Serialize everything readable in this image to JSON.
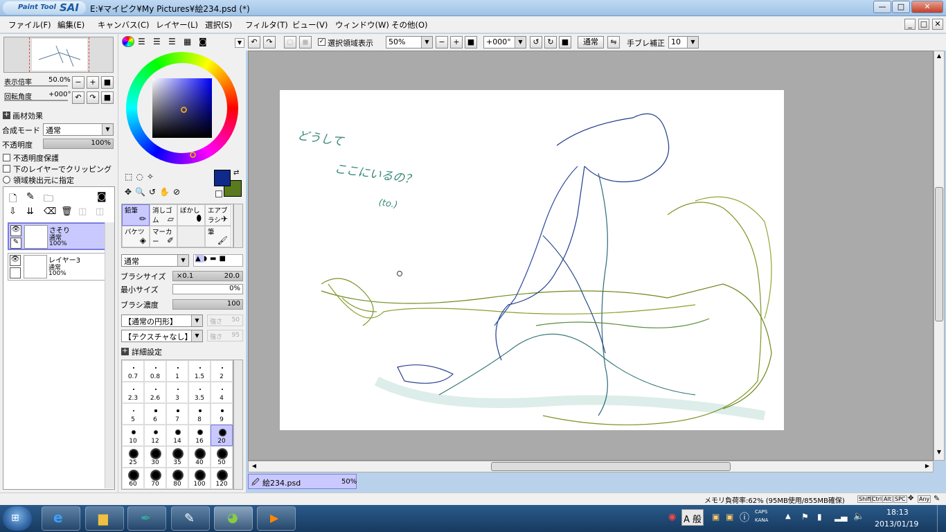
{
  "window": {
    "app_logo_text": "Paint Tool",
    "app_logo_brand": "SAI",
    "title": "E:¥マイピク¥My Pictures¥絵234.psd (*)",
    "minimize": "—",
    "maximize": "□",
    "close": "✕"
  },
  "menu": [
    "ファイル(F)",
    "編集(E)",
    "キャンバス(C)",
    "レイヤー(L)",
    "選択(S)",
    "フィルタ(T)",
    "ビュー(V)",
    "ウィンドウ(W)",
    "その他(O)"
  ],
  "navigator": {
    "zoom_label": "表示倍率",
    "zoom_value": "50.0%",
    "rotation_label": "回転角度",
    "rotation_value": "+000°"
  },
  "layer_effects": {
    "header": "画材効果",
    "blend_mode_label": "合成モード",
    "blend_mode_value": "通常",
    "opacity_label": "不透明度",
    "opacity_value": "100%",
    "opacity_fraction": 1.0,
    "protect_opacity": "不透明度保護",
    "clipping": "下のレイヤーでクリッピング",
    "selection_source": "領域検出元に指定"
  },
  "layers": [
    {
      "name": "さそり",
      "mode": "通常",
      "opacity": "100%",
      "selected": true
    },
    {
      "name": "レイヤー3",
      "mode": "通常",
      "opacity": "100%",
      "selected": false
    }
  ],
  "colors": {
    "primary": "#0f2a8a",
    "secondary": "#5a7a1e",
    "canvas_bg": "#aaaaaa",
    "selection": "#c9c9ff"
  },
  "tools": [
    {
      "label": "鉛筆",
      "selected": true
    },
    {
      "label": "消しゴム",
      "selected": false
    },
    {
      "label": "ぼかし",
      "selected": false
    },
    {
      "label": "エアブラシ",
      "selected": false
    },
    {
      "label": "バケツ",
      "selected": false
    },
    {
      "label": "マーカー",
      "selected": false
    },
    {
      "label": "",
      "selected": false
    },
    {
      "label": "筆",
      "selected": false
    }
  ],
  "brush": {
    "mode": "通常",
    "size_label": "ブラシサイズ",
    "size_multiplier": "×0.1",
    "size_value": "20.0",
    "min_size_label": "最小サイズ",
    "min_size_value": "0%",
    "min_size_fraction": 0,
    "density_label": "ブラシ濃度",
    "density_value": "100",
    "density_fraction": 1.0,
    "shape": "【通常の円形】",
    "shape_strength_label": "強さ",
    "shape_strength_value": "50",
    "texture": "【テクスチャなし】",
    "texture_strength_label": "強さ",
    "texture_strength_value": "95",
    "details_header": "詳細設定"
  },
  "brush_sizes": [
    "0.7",
    "0.8",
    "1",
    "1.5",
    "2",
    "2.3",
    "2.6",
    "3",
    "3.5",
    "4",
    "5",
    "6",
    "7",
    "8",
    "9",
    "10",
    "12",
    "14",
    "16",
    "20",
    "25",
    "30",
    "35",
    "40",
    "50",
    "60",
    "70",
    "80",
    "100",
    "120"
  ],
  "brush_size_selected": "20",
  "toolbar": {
    "show_selection_label": "選択領域表示",
    "show_selection_checked": true,
    "zoom_value": "50%",
    "rotation_value": "+000°",
    "mode_button": "通常",
    "stabilizer_label": "手ブレ補正",
    "stabilizer_value": "10"
  },
  "canvas": {
    "handwriting_lines": [
      "どうして",
      "ここにいるの？",
      "(to.)"
    ]
  },
  "doc_tab": {
    "name": "絵234.psd",
    "zoom": "50%"
  },
  "status": {
    "memory": "メモリ負荷率:62% (95MB使用/855MB確保)",
    "keys": [
      "Shift",
      "Ctrl",
      "Alt",
      "SPC",
      "Any"
    ]
  },
  "taskbar": {
    "ime": "A 般",
    "caps": "CAPS",
    "kana": "KANA",
    "time": "18:13",
    "date": "2013/01/19"
  }
}
